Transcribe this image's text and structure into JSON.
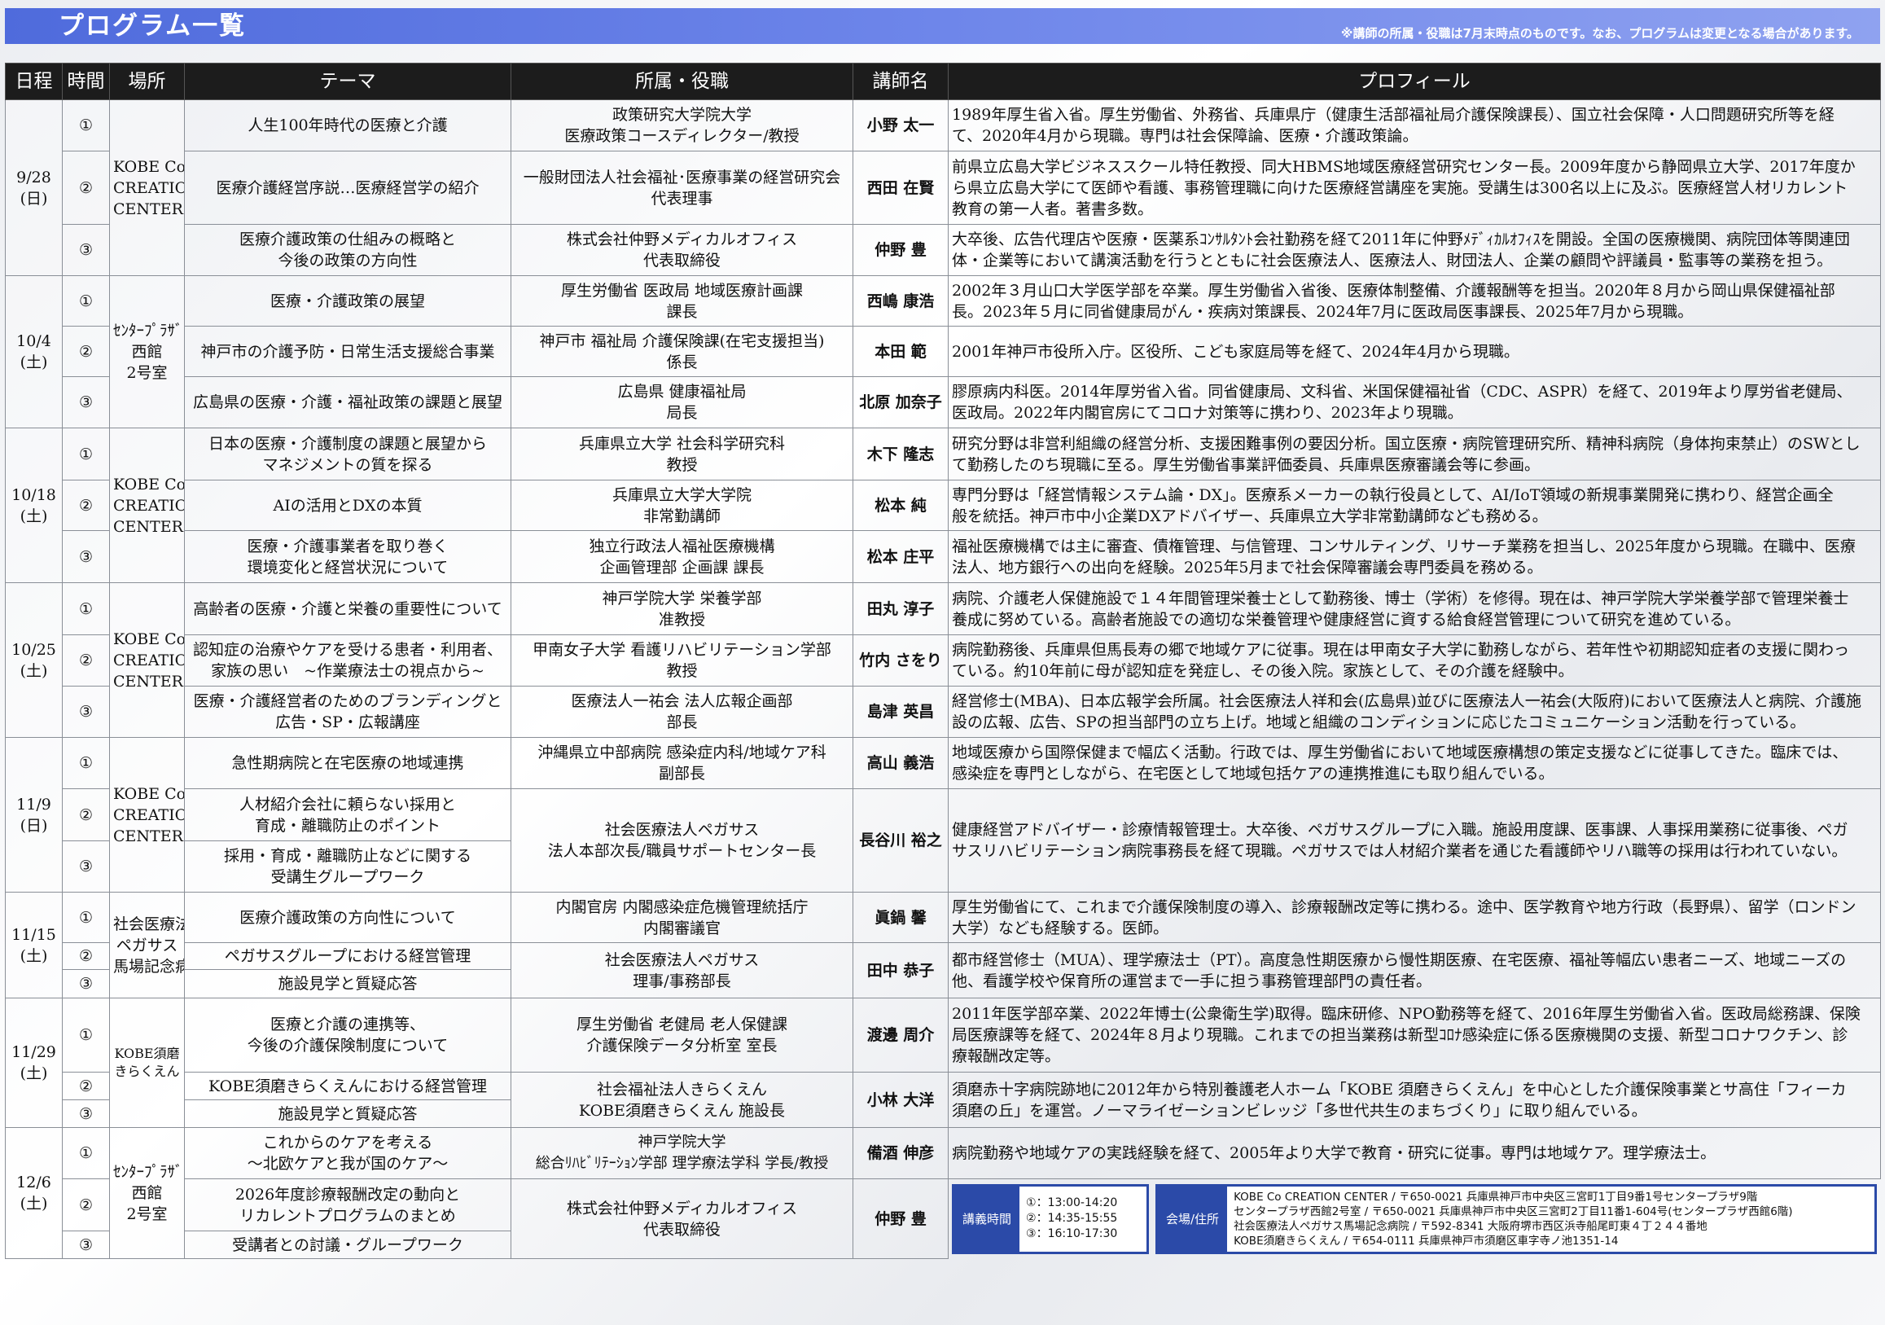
{
  "banner": {
    "title": "プログラム一覧",
    "note": "※講師の所属・役職は7月末時点のものです。なお、プログラムは変更となる場合があります。"
  },
  "colors": {
    "banner": "#5f7be6",
    "header": "#1c1c1c",
    "info_accent": "#2b4aa8"
  },
  "headers": {
    "date": "日程",
    "time": "時間",
    "place": "場所",
    "theme": "テーマ",
    "affiliation": "所属・役職",
    "lecturer": "講師名",
    "profile": "プロフィール"
  },
  "sessions": [
    {
      "date": [
        "9/28",
        "(日)"
      ],
      "place": [
        "KOBE Co",
        "CREATION",
        "CENTER"
      ],
      "rows": [
        {
          "time": "①",
          "theme": [
            "人生100年時代の医療と介護"
          ],
          "aff": [
            "政策研究大学院大学",
            "医療政策コースディレクター/教授"
          ],
          "lecturer": "小野 太一",
          "profile": [
            "1989年厚生省入省。厚生労働省、外務省、兵庫県庁（健康生活部福祉局介護保険課長）、国立社会保障・人口問題研究所等を経",
            "て、2020年4月から現職。専門は社会保障論、医療・介護政策論。"
          ]
        },
        {
          "time": "②",
          "theme": [
            "医療介護経営序説…医療経営学の紹介"
          ],
          "aff": [
            "一般財団法人社会福祉･医療事業の経営研究会",
            "代表理事"
          ],
          "lecturer": "西田 在賢",
          "profile": [
            "前県立広島大学ビジネススクール特任教授、同大HBMS地域医療経営研究センター長。2009年度から静岡県立大学、2017年度か",
            "ら県立広島大学にて医師や看護、事務管理職に向けた医療経営講座を実施。受講生は300名以上に及ぶ。医療経営人材リカレント",
            "教育の第一人者。著書多数。"
          ]
        },
        {
          "time": "③",
          "theme": [
            "医療介護政策の仕組みの概略と",
            "今後の政策の方向性"
          ],
          "aff": [
            "株式会社仲野メディカルオフィス",
            "代表取締役"
          ],
          "lecturer": "仲野 豊",
          "profile": [
            "大卒後、広告代理店や医療・医薬系ｺﾝｻﾙﾀﾝﾄ会社勤務を経て2011年に仲野ﾒﾃﾞｨｶﾙｵﾌｨｽを開設。全国の医療機関、病院団体等関連団",
            "体・企業等において講演活動を行うとともに社会医療法人、医療法人、財団法人、企業の顧問や評議員・監事等の業務を担う。"
          ]
        }
      ]
    },
    {
      "date": [
        "10/4",
        "(土)"
      ],
      "place": [
        "ｾﾝﾀｰﾌﾟﾗｻﾞ",
        "西館",
        "2号室"
      ],
      "rows": [
        {
          "time": "①",
          "theme": [
            "医療・介護政策の展望"
          ],
          "aff": [
            "厚生労働省 医政局 地域医療計画課",
            "課長"
          ],
          "lecturer": "西嶋 康浩",
          "profile": [
            "2002年３月山口大学医学部を卒業。厚生労働省入省後、医療体制整備、介護報酬等を担当。2020年８月から岡山県保健福祉部",
            "長。2023年５月に同省健康局がん・疾病対策課長、2024年7月に医政局医事課長、2025年7月から現職。"
          ]
        },
        {
          "time": "②",
          "theme": [
            "神戸市の介護予防・日常生活支援総合事業"
          ],
          "aff": [
            "神戸市 福祉局 介護保険課(在宅支援担当)",
            "係長"
          ],
          "lecturer": "本田 範",
          "profile": [
            "2001年神戸市役所入庁。区役所、こども家庭局等を経て、2024年4月から現職。"
          ]
        },
        {
          "time": "③",
          "theme": [
            "広島県の医療・介護・福祉政策の課題と展望"
          ],
          "aff": [
            "広島県 健康福祉局",
            "局長"
          ],
          "lecturer": "北原 加奈子",
          "profile": [
            "膠原病内科医。2014年厚労省入省。同省健康局、文科省、米国保健福祉省（CDC、ASPR）を経て、2019年より厚労省老健局、",
            "医政局。2022年内閣官房にてコロナ対策等に携わり、2023年より現職。"
          ]
        }
      ]
    },
    {
      "date": [
        "10/18",
        "(土)"
      ],
      "place": [
        "KOBE Co",
        "CREATION",
        "CENTER"
      ],
      "rows": [
        {
          "time": "①",
          "theme": [
            "日本の医療・介護制度の課題と展望から",
            "マネジメントの質を探る"
          ],
          "aff": [
            "兵庫県立大学 社会科学研究科",
            "教授"
          ],
          "lecturer": "木下 隆志",
          "profile": [
            "研究分野は非営利組織の経営分析、支援困難事例の要因分析。国立医療・病院管理研究所、精神科病院（身体拘束禁止）のSWとし",
            "て勤務したのち現職に至る。厚生労働省事業評価委員、兵庫県医療審議会等に参画。"
          ]
        },
        {
          "time": "②",
          "theme": [
            "AIの活用とDXの本質"
          ],
          "aff": [
            "兵庫県立大学大学院",
            "非常勤講師"
          ],
          "lecturer": "松本 純",
          "profile": [
            "専門分野は「経営情報システム論・DX」。医療系メーカーの執行役員として、AI/IoT領域の新規事業開発に携わり、経営企画全",
            "般を統括。神戸市中小企業DXアドバイザー、兵庫県立大学非常勤講師なども務める。"
          ]
        },
        {
          "time": "③",
          "theme": [
            "医療・介護事業者を取り巻く",
            "環境変化と経営状況について"
          ],
          "aff": [
            "独立行政法人福祉医療機構",
            "企画管理部 企画課 課長"
          ],
          "lecturer": "松本 庄平",
          "profile": [
            "福祉医療機構では主に審査、債権管理、与信管理、コンサルティング、リサーチ業務を担当し、2025年度から現職。在職中、医療",
            "法人、地方銀行への出向を経験。2025年5月まで社会保障審議会専門委員を務める。"
          ]
        }
      ]
    },
    {
      "date": [
        "10/25",
        "(土)"
      ],
      "place": [
        "KOBE Co",
        "CREATION",
        "CENTER"
      ],
      "rows": [
        {
          "time": "①",
          "theme": [
            "高齢者の医療・介護と栄養の重要性について"
          ],
          "aff": [
            "神戸学院大学 栄養学部",
            "准教授"
          ],
          "lecturer": "田丸 淳子",
          "profile": [
            "病院、介護老人保健施設で１４年間管理栄養士として勤務後、博士（学術）を修得。現在は、神戸学院大学栄養学部で管理栄養士",
            "養成に努めている。高齢者施設での適切な栄養管理や健康経営に資する給食経営管理について研究を進めている。"
          ]
        },
        {
          "time": "②",
          "theme": [
            "認知症の治療やケアを受ける患者・利用者、",
            "家族の思い　~作業療法士の視点から~"
          ],
          "aff": [
            "甲南女子大学 看護リハビリテーション学部",
            "教授"
          ],
          "lecturer": "竹内 さをり",
          "profile": [
            "病院勤務後、兵庫県但馬長寿の郷で地域ケアに従事。現在は甲南女子大学に勤務しながら、若年性や初期認知症者の支援に関わっ",
            "ている。約10年前に母が認知症を発症し、その後入院。家族として、その介護を経験中。"
          ]
        },
        {
          "time": "③",
          "theme": [
            "医療・介護経営者のためのブランディングと",
            "広告・SP・広報講座"
          ],
          "aff": [
            "医療法人一祐会 法人広報企画部",
            "部長"
          ],
          "lecturer": "島津 英昌",
          "profile": [
            "経営修士(MBA)、日本広報学会所属。社会医療法人祥和会(広島県)並びに医療法人一祐会(大阪府)において医療法人と病院、介護施",
            "設の広報、広告、SPの担当部門の立ち上げ。地域と組織のコンディションに応じたコミュニケーション活動を行っている。"
          ]
        }
      ]
    },
    {
      "date": [
        "11/9",
        "(日)"
      ],
      "place": [
        "KOBE Co",
        "CREATION",
        "CENTER"
      ],
      "rows": [
        {
          "time": "①",
          "theme": [
            "急性期病院と在宅医療の地域連携"
          ],
          "aff": [
            "沖縄県立中部病院 感染症内科/地域ケア科",
            "副部長"
          ],
          "lecturer": "高山 義浩",
          "profile": [
            "地域医療から国際保健まで幅広く活動。行政では、厚生労働省において地域医療構想の策定支援などに従事してきた。臨床では、",
            "感染症を専門としながら、在宅医として地域包括ケアの連携推進にも取り組んでいる。"
          ]
        },
        {
          "time": "②",
          "theme": [
            "人材紹介会社に頼らない採用と",
            "育成・離職防止のポイント"
          ],
          "aff": [
            "社会医療法人ペガサス",
            "法人本部次長/職員サポートセンター長"
          ],
          "lecturer": "長谷川 裕之",
          "profile": [
            "健康経営アドバイザー・診療情報管理士。大卒後、ペガサスグループに入職。施設用度課、医事課、人事採用業務に従事後、ペガ",
            "サスリハビリテーション病院事務長を経て現職。ペガサスでは人材紹介業者を通じた看護師やリハ職等の採用は行われていない。"
          ]
        },
        {
          "time": "③",
          "theme": [
            "採用・育成・離職防止などに関する",
            "受講生グループワーク"
          ]
        }
      ]
    },
    {
      "date": [
        "11/15",
        "(土)"
      ],
      "place": [
        "社会医療法人",
        "ペガサス",
        "馬場記念病院"
      ],
      "rows": [
        {
          "time": "①",
          "theme": [
            "医療介護政策の方向性について"
          ],
          "aff": [
            "内閣官房 内閣感染症危機管理統括庁",
            "内閣審議官"
          ],
          "lecturer": "眞鍋 馨",
          "profile": [
            "厚生労働省にて、これまで介護保険制度の導入、診療報酬改定等に携わる。途中、医学教育や地方行政（長野県）、留学（ロンドン",
            "大学）なども経験する。医師。"
          ]
        },
        {
          "time": "②",
          "theme": [
            "ペガサスグループにおける経営管理"
          ],
          "aff": [
            "社会医療法人ペガサス",
            "理事/事務部長"
          ],
          "lecturer": "田中 恭子",
          "profile": [
            "都市経営修士（MUA）、理学療法士（PT）。高度急性期医療から慢性期医療、在宅医療、福祉等幅広い患者ニーズ、地域ニーズの",
            "他、看護学校や保育所の運営まで一手に担う事務管理部門の責任者。"
          ]
        },
        {
          "time": "③",
          "theme": [
            "施設見学と質疑応答"
          ]
        }
      ]
    },
    {
      "date": [
        "11/29",
        "(土)"
      ],
      "place": [
        "KOBE須磨",
        "きらくえん"
      ],
      "rows": [
        {
          "time": "①",
          "theme": [
            "医療と介護の連携等、",
            "今後の介護保険制度について"
          ],
          "aff": [
            "厚生労働省 老健局 老人保健課",
            "介護保険データ分析室 室長"
          ],
          "lecturer": "渡邊 周介",
          "profile": [
            "2011年医学部卒業、2022年博士(公衆衛生学)取得。臨床研修、NPO勤務等を経て、2016年厚生労働省入省。医政局総務課、保険",
            "局医療課等を経て、2024年８月より現職。これまでの担当業務は新型ｺﾛﾅ感染症に係る医療機関の支援、新型コロナワクチン、診",
            "療報酬改定等。"
          ]
        },
        {
          "time": "②",
          "theme": [
            "KOBE須磨きらくえんにおける経営管理"
          ],
          "aff": [
            "社会福祉法人きらくえん",
            "KOBE須磨きらくえん 施設長"
          ],
          "lecturer": "小林 大洋",
          "profile": [
            "須磨赤十字病院跡地に2012年から特別養護老人ホーム「KOBE 須磨きらくえん」を中心とした介護保険事業とサ高住「フィーカ",
            "須磨の丘」を運営。ノーマライゼーションビレッジ「多世代共生のまちづくり」に取り組んでいる。"
          ]
        },
        {
          "time": "③",
          "theme": [
            "施設見学と質疑応答"
          ]
        }
      ]
    },
    {
      "date": [
        "12/6",
        "(土)"
      ],
      "place": [
        "ｾﾝﾀｰﾌﾟﾗｻﾞ",
        "西館",
        "2号室"
      ],
      "rows": [
        {
          "time": "①",
          "theme": [
            "これからのケアを考える",
            "～北欧ケアと我が国のケア～"
          ],
          "aff": [
            "神戸学院大学",
            "総合ﾘﾊﾋﾞﾘﾃｰｼｮﾝ学部 理学療法学科 学長/教授"
          ],
          "lecturer": "備酒 伸彦",
          "profile": [
            "病院勤務や地域ケアの実践経験を経て、2005年より大学で教育・研究に従事。専門は地域ケア。理学療法士。"
          ]
        },
        {
          "time": "②",
          "theme": [
            "2026年度診療報酬改定の動向と",
            "リカレントプログラムのまとめ"
          ],
          "aff": [
            "株式会社仲野メディカルオフィス",
            "代表取締役"
          ],
          "lecturer": "仲野 豊"
        },
        {
          "time": "③",
          "theme": [
            "受講者との討議・グループワーク"
          ]
        }
      ]
    }
  ],
  "info": {
    "times_label": "講義時間",
    "times": [
      "①：13:00-14:20",
      "②：14:35-15:55",
      "③：16:10-17:30"
    ],
    "venue_label": "会場/住所",
    "venues": [
      "KOBE Co CREATION CENTER / 〒650-0021 兵庫県神戸市中央区三宮町1丁目9番1号センタープラザ9階",
      "センタープラザ西館2号室 / 〒650-0021 兵庫県神戸市中央区三宮町2丁目11番1-604号(センタープラザ西館6階)",
      "社会医療法人ペガサス馬場記念病院 / 〒592-8341 大阪府堺市西区浜寺船尾町東４丁２４４番地",
      "KOBE須磨きらくえん / 〒654-0111 兵庫県神戸市須磨区車字寺ノ池1351-14"
    ]
  }
}
